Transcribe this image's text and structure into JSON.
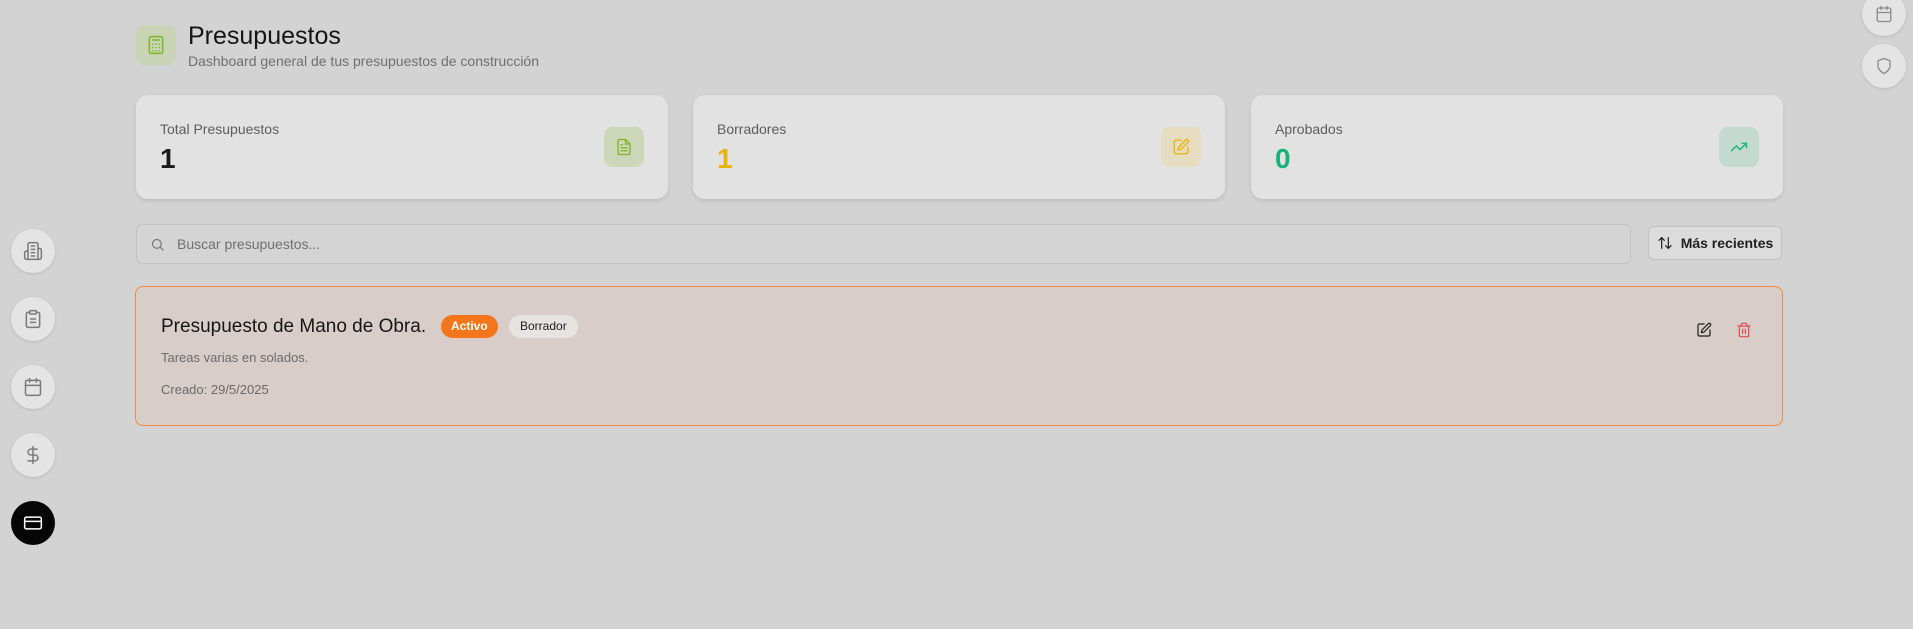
{
  "header": {
    "title": "Presupuestos",
    "subtitle": "Dashboard general de tus presupuestos de construcción",
    "icon": "calculator-icon"
  },
  "sidebar": {
    "items": [
      {
        "icon": "building-icon"
      },
      {
        "icon": "clipboard-icon"
      },
      {
        "icon": "calendar-icon"
      },
      {
        "icon": "dollar-icon"
      },
      {
        "icon": "credit-card-icon",
        "active": true
      }
    ]
  },
  "right_toolbar": {
    "items": [
      {
        "icon": "calendar-icon"
      },
      {
        "icon": "shield-icon"
      }
    ]
  },
  "stats": [
    {
      "label": "Total Presupuestos",
      "value": "1",
      "color": "#1a1a1a",
      "icon": "file-text-icon",
      "icon_color": "#7fb520",
      "icon_bg": "#ccd6b8"
    },
    {
      "label": "Borradores",
      "value": "1",
      "color": "#eab308",
      "icon": "edit-icon",
      "icon_color": "#eab308",
      "icon_bg": "#e6dcc0"
    },
    {
      "label": "Aprobados",
      "value": "0",
      "color": "#16b37a",
      "icon": "trending-up-icon",
      "icon_color": "#16b37a",
      "icon_bg": "#c4d9cf"
    }
  ],
  "search": {
    "placeholder": "Buscar presupuestos...",
    "value": ""
  },
  "sort": {
    "label": "Más recientes"
  },
  "budgets": [
    {
      "title": "Presupuesto de Mano de Obra.",
      "status_badge": "Activo",
      "state_badge": "Borrador",
      "description": "Tareas varias en solados.",
      "created": "Creado: 29/5/2025",
      "accent": "#f08a3a"
    }
  ]
}
